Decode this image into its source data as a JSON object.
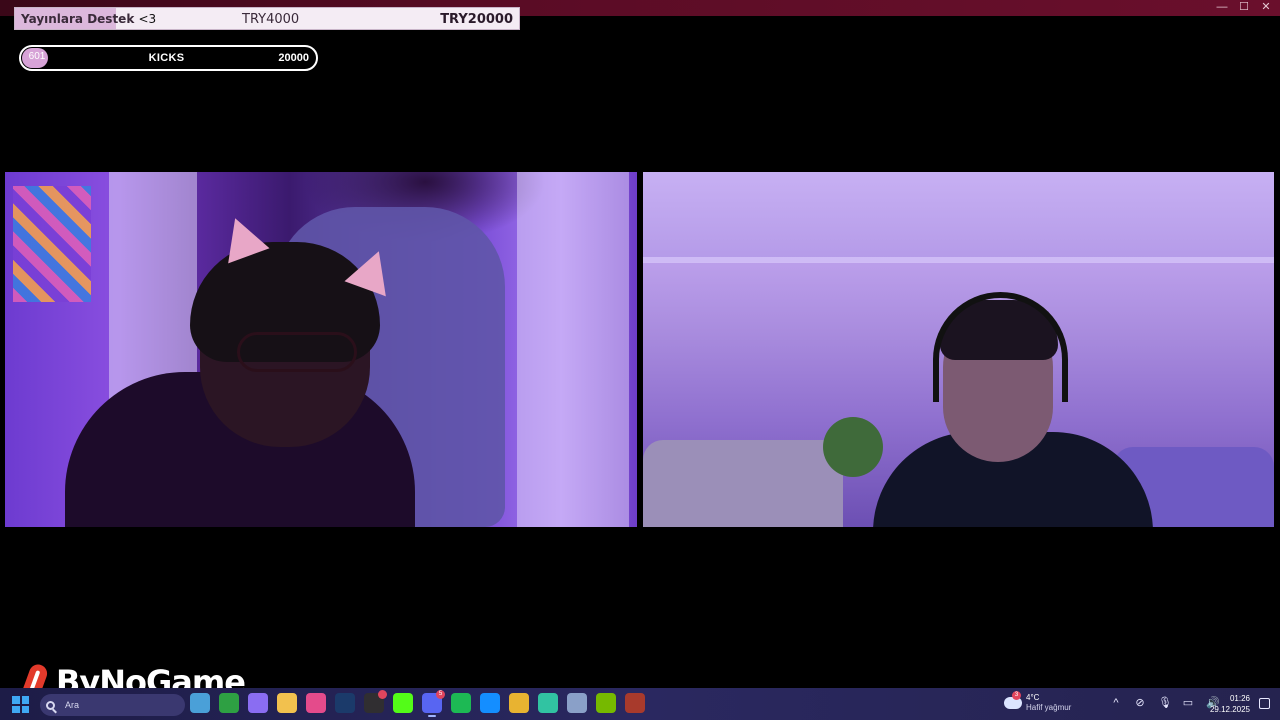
{
  "window": {
    "controls": [
      {
        "name": "minimize",
        "glyph": "—"
      },
      {
        "name": "maximize",
        "glyph": "☐"
      },
      {
        "name": "close",
        "glyph": "✕"
      }
    ]
  },
  "donation_goal": {
    "title": "Yayınlara Destek",
    "heart": "<3",
    "current": "TRY4000",
    "target": "TRY20000",
    "progress_fraction": 0.2,
    "fill_color": "#dcb8dc"
  },
  "kicks_goal": {
    "count": "601",
    "label": "KICKS",
    "target": "20000",
    "progress_fraction": 0.03,
    "fill_color": "#d7a3d7"
  },
  "cameras": [
    {
      "name": "left-streamer-webcam"
    },
    {
      "name": "right-streamer-webcam"
    }
  ],
  "logo": {
    "text": "ByNoGame",
    "accent": "#e23a2b"
  },
  "taskbar": {
    "search_text": "Ara",
    "apps": [
      {
        "name": "file-explorer-widget-icon",
        "color": "#4aa0d8"
      },
      {
        "name": "xbox-icon",
        "color": "#2ea043"
      },
      {
        "name": "copilot-icon",
        "color": "#8a6df2"
      },
      {
        "name": "folder-icon",
        "color": "#f2c14e"
      },
      {
        "name": "osu-icon",
        "color": "#e44b8b"
      },
      {
        "name": "steam-icon",
        "color": "#1b3a6a"
      },
      {
        "name": "obs-icon",
        "color": "#302e31",
        "badge": ""
      },
      {
        "name": "kick-app-icon",
        "color": "#53fc18"
      },
      {
        "name": "discord-icon",
        "color": "#5865f2",
        "badge": "5",
        "active": true
      },
      {
        "name": "spotify-icon",
        "color": "#1db954"
      },
      {
        "name": "battlenet-icon",
        "color": "#148eff"
      },
      {
        "name": "chrome-icon",
        "color": "#e8b331"
      },
      {
        "name": "streamlabs-icon",
        "color": "#31c3a2"
      },
      {
        "name": "settings-icon",
        "color": "#8aa0c8"
      },
      {
        "name": "nvidia-icon",
        "color": "#76b900"
      },
      {
        "name": "winrar-icon",
        "color": "#a83a2c"
      }
    ],
    "weather": {
      "temp": "4°C",
      "desc": "Hafif yağmur",
      "badge": "3"
    },
    "tray": [
      {
        "name": "chevron-up-icon",
        "glyph": "^"
      },
      {
        "name": "network-off-icon",
        "glyph": "⊘"
      },
      {
        "name": "microphone-icon",
        "glyph": "🎙"
      },
      {
        "name": "display-icon",
        "glyph": "▭"
      },
      {
        "name": "volume-icon",
        "glyph": "🔊"
      }
    ],
    "clock": {
      "time": "01:26",
      "date": "29.12.2025"
    }
  }
}
